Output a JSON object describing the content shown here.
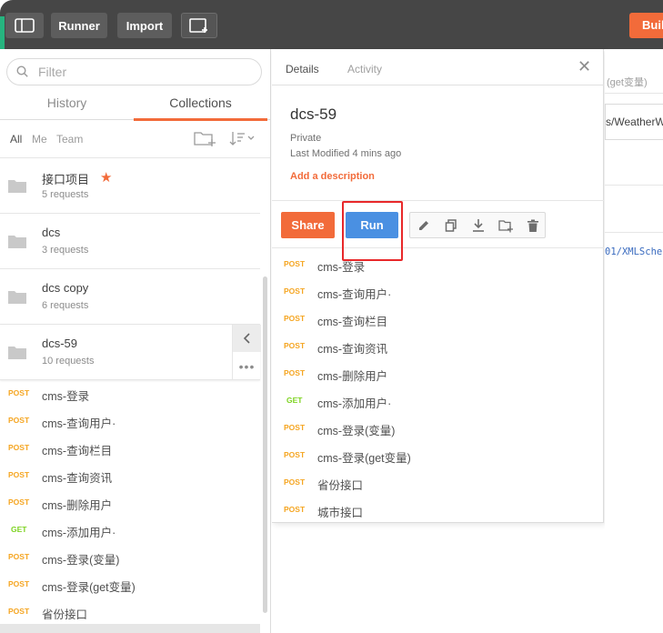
{
  "topbar": {
    "runner_label": "Runner",
    "import_label": "Import",
    "builder_label": "Builder"
  },
  "sidebar": {
    "search_placeholder": "Filter",
    "tabs": [
      {
        "label": "History"
      },
      {
        "label": "Collections"
      }
    ],
    "filters": [
      {
        "label": "All"
      },
      {
        "label": "Me"
      },
      {
        "label": "Team"
      }
    ],
    "collections": [
      {
        "name": "接口项目",
        "count": "5 requests",
        "starred": true
      },
      {
        "name": "dcs",
        "count": "3 requests"
      },
      {
        "name": "dcs copy",
        "count": "6 requests"
      },
      {
        "name": "dcs-59",
        "count": "10 requests"
      }
    ],
    "requests": [
      {
        "method": "POST",
        "name": "cms-登录"
      },
      {
        "method": "POST",
        "name": "cms-查询用户·"
      },
      {
        "method": "POST",
        "name": "cms-查询栏目"
      },
      {
        "method": "POST",
        "name": "cms-查询资讯"
      },
      {
        "method": "POST",
        "name": "cms-删除用户"
      },
      {
        "method": "GET",
        "name": "cms-添加用户·"
      },
      {
        "method": "POST",
        "name": "cms-登录(变量)"
      },
      {
        "method": "POST",
        "name": "cms-登录(get变量)"
      },
      {
        "method": "POST",
        "name": "省份接口"
      }
    ]
  },
  "details": {
    "tabs": [
      {
        "label": "Details"
      },
      {
        "label": "Activity"
      }
    ],
    "close_glyph": "✕",
    "title": "dcs-59",
    "visibility": "Private",
    "last_modified": "Last Modified 4 mins ago",
    "add_description": "Add a description",
    "share_label": "Share",
    "run_label": "Run",
    "requests": [
      {
        "method": "POST",
        "name": "cms-登录"
      },
      {
        "method": "POST",
        "name": "cms-查询用户·"
      },
      {
        "method": "POST",
        "name": "cms-查询栏目"
      },
      {
        "method": "POST",
        "name": "cms-查询资讯"
      },
      {
        "method": "POST",
        "name": "cms-删除用户"
      },
      {
        "method": "GET",
        "name": "cms-添加用户·"
      },
      {
        "method": "POST",
        "name": "cms-登录(变量)"
      },
      {
        "method": "POST",
        "name": "cms-登录(get变量)"
      },
      {
        "method": "POST",
        "name": "省份接口"
      },
      {
        "method": "POST",
        "name": "城市接口"
      }
    ]
  },
  "editor_peek": {
    "tab_text": "(get变量)",
    "url_text": "s/WeatherW",
    "code_text": "01/XMLSche"
  },
  "colors": {
    "accent": "#f26b3a",
    "run_blue": "#4a90e2",
    "post": "#f5a623",
    "get": "#7ed321",
    "highlight_red": "#e8282a"
  },
  "icons": [
    "sidebar-toggle-icon",
    "new-tab-icon",
    "search-icon",
    "new-folder-icon",
    "sort-icon",
    "folder-icon",
    "star-icon",
    "chevron-left-icon",
    "more-icon",
    "close-icon",
    "edit-icon",
    "duplicate-icon",
    "download-icon",
    "add-folder-icon",
    "trash-icon"
  ]
}
